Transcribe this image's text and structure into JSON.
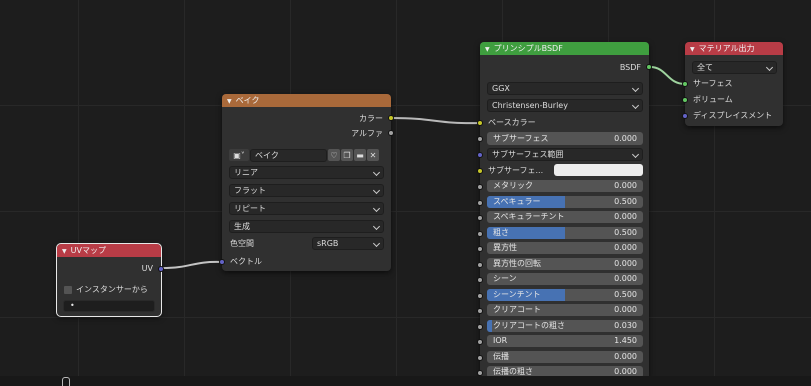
{
  "colors": {
    "bake_header": "#a9693a",
    "bsdf_header": "#3f9e3f",
    "output_header": "#b83c46",
    "uv_header": "#b83c46",
    "field_fill": "#4772b3"
  },
  "bake": {
    "title": "ベイク",
    "out_color": "カラー",
    "out_alpha": "アルファ",
    "image_name": "ベイク",
    "interpolation": "リニア",
    "projection": "フラット",
    "extension": "リピート",
    "source": "生成",
    "colorspace_label": "色空間",
    "colorspace_value": "sRGB",
    "in_vector": "ベクトル"
  },
  "uvmap": {
    "title": "UVマップ",
    "out_uv": "UV",
    "instancer_label": "インスタンサーから",
    "uv_field_value": "•"
  },
  "bsdf": {
    "title": "プリンシプルBSDF",
    "out_bsdf": "BSDF",
    "distribution": "GGX",
    "subsurface_method": "Christensen-Burley",
    "base_color_label": "ベースカラー",
    "subsurface_label": "サブサーフェス",
    "subsurface_value": "0.000",
    "subsurface_radius": "サブサーフェス範囲",
    "subsurface_color_label": "サブサーフェ...",
    "fields": [
      {
        "label": "メタリック",
        "value": "0.000",
        "fill": 0
      },
      {
        "label": "スペキュラー",
        "value": "0.500",
        "fill": 0.5
      },
      {
        "label": "スペキュラーチント",
        "value": "0.000",
        "fill": 0
      },
      {
        "label": "粗さ",
        "value": "0.500",
        "fill": 0.5
      },
      {
        "label": "異方性",
        "value": "0.000",
        "fill": 0
      },
      {
        "label": "異方性の回転",
        "value": "0.000",
        "fill": 0
      },
      {
        "label": "シーン",
        "value": "0.000",
        "fill": 0
      },
      {
        "label": "シーンチント",
        "value": "0.500",
        "fill": 0.5
      },
      {
        "label": "クリアコート",
        "value": "0.000",
        "fill": 0
      },
      {
        "label": "クリアコートの粗さ",
        "value": "0.030",
        "fill": 0.03
      },
      {
        "label": "IOR",
        "value": "1.450",
        "fill": 0
      },
      {
        "label": "伝播",
        "value": "0.000",
        "fill": 0
      },
      {
        "label": "伝播の粗さ",
        "value": "0.000",
        "fill": 0
      }
    ]
  },
  "output": {
    "title": "マテリアル出力",
    "target": "全て",
    "in_surface": "サーフェス",
    "in_volume": "ボリューム",
    "in_displacement": "ディスプレイスメント"
  }
}
